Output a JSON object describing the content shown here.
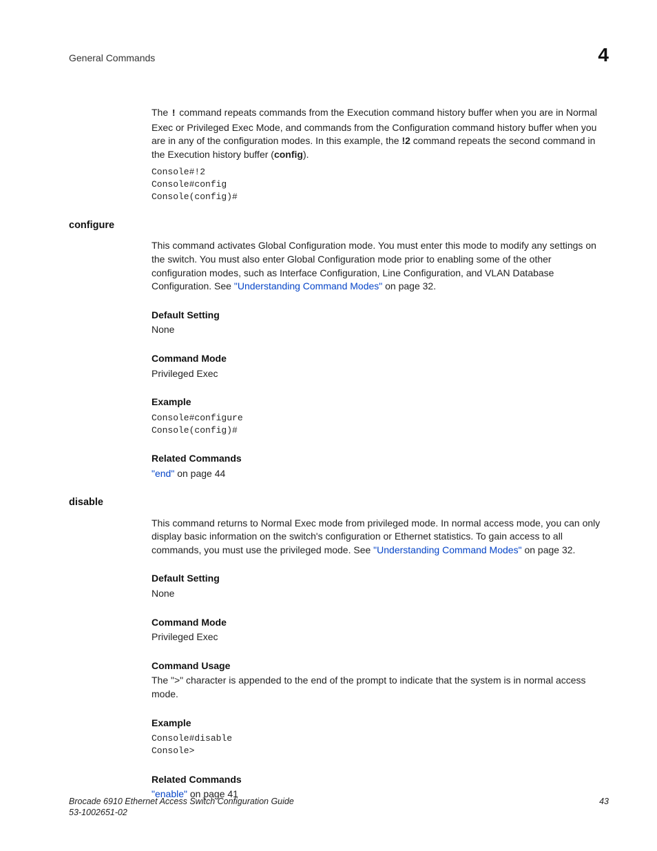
{
  "header": {
    "title": "General Commands",
    "chapter": "4"
  },
  "intro": {
    "p1a": "The ",
    "p1b": "!",
    "p1c": " command repeats commands from the Execution command history buffer when you are in Normal Exec or Privileged Exec Mode, and commands from the Configuration command history buffer when you are in any of the configuration modes. In this example, the ",
    "p1d": "!2",
    "p1e": " command repeats the second command in the Execution history buffer (",
    "p1f": "config",
    "p1g": ").",
    "code": "Console#!2\nConsole#config\nConsole(config)#"
  },
  "configure": {
    "heading": "configure",
    "p1a": "This command activates Global Configuration mode. You must enter this mode to modify any settings on the switch. You must also enter Global Configuration mode prior to enabling some of the other configuration modes, such as Interface Configuration, Line Configuration, and VLAN Database Configuration. See ",
    "link1": "\"Understanding Command Modes\"",
    "p1b": " on page 32.",
    "default_h": "Default Setting",
    "default_v": "None",
    "mode_h": "Command Mode",
    "mode_v": "Privileged Exec",
    "example_h": "Example",
    "example_code": "Console#configure\nConsole(config)#",
    "related_h": "Related Commands",
    "related_link": "\"end\"",
    "related_tail": " on page 44"
  },
  "disable": {
    "heading": "disable",
    "p1a": "This command returns to Normal Exec mode from privileged mode. In normal access mode, you can only display basic information on the switch's configuration or Ethernet statistics. To gain access to all commands, you must use the privileged mode. See ",
    "link1": "\"Understanding Command Modes\"",
    "p1b": " on page 32.",
    "default_h": "Default Setting",
    "default_v": "None",
    "mode_h": "Command Mode",
    "mode_v": "Privileged Exec",
    "usage_h": "Command Usage",
    "usage_v": "The \">\" character is appended to the end of the prompt to indicate that the system is in normal access mode.",
    "example_h": "Example",
    "example_code": "Console#disable\nConsole>",
    "related_h": "Related Commands",
    "related_link": "\"enable\"",
    "related_tail": " on page 41"
  },
  "footer": {
    "doc_title": "Brocade 6910 Ethernet Access Switch Configuration Guide",
    "doc_num": "53-1002651-02",
    "page": "43"
  }
}
